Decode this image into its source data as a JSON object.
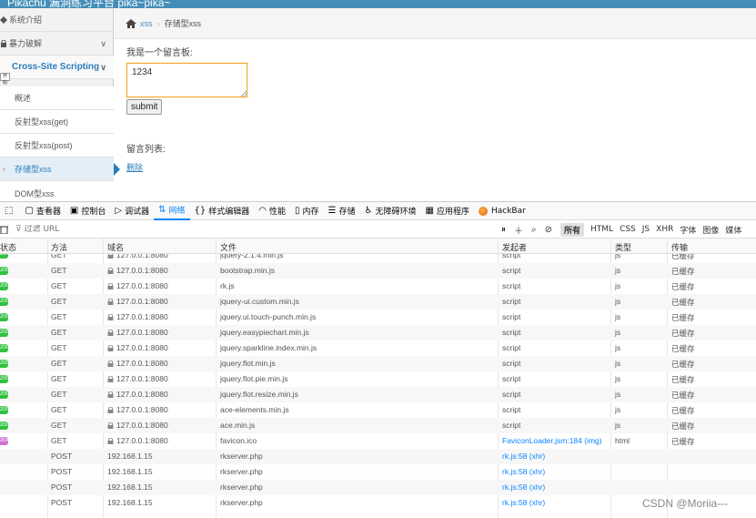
{
  "banner": {
    "title": "Pikachu 漏洞练习平台 pika~pika~"
  },
  "sidebar": {
    "items": [
      {
        "label": "系统介绍"
      },
      {
        "label": "暴力破解"
      },
      {
        "label": "Cross-Site Scripting"
      },
      {
        "label": "概述"
      },
      {
        "label": "反射型xss(get)"
      },
      {
        "label": "反射型xss(post)"
      },
      {
        "label": "存储型xss"
      },
      {
        "label": "DOM型xss"
      }
    ],
    "tooltip_tag": "开始"
  },
  "breadcrumb": {
    "section": "xss",
    "separator": "›",
    "current": "存储型xss"
  },
  "form": {
    "board_label": "我是一个留言板:",
    "message_value": "1234",
    "submit_label": "submit",
    "list_label": "留言列表:",
    "delete_label": "删除"
  },
  "devtools": {
    "tabs": [
      {
        "icon": "inspector-icon",
        "label": "查看器"
      },
      {
        "icon": "console-icon",
        "label": "控制台"
      },
      {
        "icon": "debugger-icon",
        "label": "调试器"
      },
      {
        "icon": "network-icon",
        "label": "网络"
      },
      {
        "icon": "style-editor-icon",
        "label": "样式编辑器"
      },
      {
        "icon": "performance-icon",
        "label": "性能"
      },
      {
        "icon": "memory-icon",
        "label": "内存"
      },
      {
        "icon": "storage-icon",
        "label": "存储"
      },
      {
        "icon": "accessibility-icon",
        "label": "无障碍环境"
      },
      {
        "icon": "application-icon",
        "label": "应用程序"
      },
      {
        "icon": "hackbar-icon",
        "label": "HackBar"
      }
    ],
    "active_tab": "网络",
    "filter_placeholder": "过滤 URL",
    "type_filters": [
      "所有",
      "HTML",
      "CSS",
      "JS",
      "XHR",
      "字体",
      "图像",
      "媒体"
    ],
    "selected_type_filter": "所有",
    "columns": {
      "status": "状态",
      "method": "方法",
      "domain": "域名",
      "file": "文件",
      "initiator": "发起者",
      "type": "类型",
      "transferred": "传输"
    },
    "requests": [
      {
        "status": "200",
        "method": "GET",
        "domain": "127.0.0.1:8080",
        "file": "jquery-2.1.4.min.js",
        "initiator": "script",
        "type": "js",
        "transferred": "已缓存",
        "secure_lock": true,
        "partial": true
      },
      {
        "status": "200",
        "method": "GET",
        "domain": "127.0.0.1:8080",
        "file": "bootstrap.min.js",
        "initiator": "script",
        "type": "js",
        "transferred": "已缓存",
        "secure_lock": true
      },
      {
        "status": "200",
        "method": "GET",
        "domain": "127.0.0.1:8080",
        "file": "rk.js",
        "initiator": "script",
        "type": "js",
        "transferred": "已缓存",
        "secure_lock": true
      },
      {
        "status": "200",
        "method": "GET",
        "domain": "127.0.0.1:8080",
        "file": "jquery-ui.custom.min.js",
        "initiator": "script",
        "type": "js",
        "transferred": "已缓存",
        "secure_lock": true
      },
      {
        "status": "200",
        "method": "GET",
        "domain": "127.0.0.1:8080",
        "file": "jquery.ui.touch-punch.min.js",
        "initiator": "script",
        "type": "js",
        "transferred": "已缓存",
        "secure_lock": true
      },
      {
        "status": "200",
        "method": "GET",
        "domain": "127.0.0.1:8080",
        "file": "jquery.easypiechart.min.js",
        "initiator": "script",
        "type": "js",
        "transferred": "已缓存",
        "secure_lock": true
      },
      {
        "status": "200",
        "method": "GET",
        "domain": "127.0.0.1:8080",
        "file": "jquery.sparkline.index.min.js",
        "initiator": "script",
        "type": "js",
        "transferred": "已缓存",
        "secure_lock": true
      },
      {
        "status": "200",
        "method": "GET",
        "domain": "127.0.0.1:8080",
        "file": "jquery.flot.min.js",
        "initiator": "script",
        "type": "js",
        "transferred": "已缓存",
        "secure_lock": true
      },
      {
        "status": "200",
        "method": "GET",
        "domain": "127.0.0.1:8080",
        "file": "jquery.flot.pie.min.js",
        "initiator": "script",
        "type": "js",
        "transferred": "已缓存",
        "secure_lock": true
      },
      {
        "status": "200",
        "method": "GET",
        "domain": "127.0.0.1:8080",
        "file": "jquery.flot.resize.min.js",
        "initiator": "script",
        "type": "js",
        "transferred": "已缓存",
        "secure_lock": true
      },
      {
        "status": "200",
        "method": "GET",
        "domain": "127.0.0.1:8080",
        "file": "ace-elements.min.js",
        "initiator": "script",
        "type": "js",
        "transferred": "已缓存",
        "secure_lock": true
      },
      {
        "status": "200",
        "method": "GET",
        "domain": "127.0.0.1:8080",
        "file": "ace.min.js",
        "initiator": "script",
        "type": "js",
        "transferred": "已缓存",
        "secure_lock": true
      },
      {
        "status": "304",
        "method": "GET",
        "domain": "127.0.0.1:8080",
        "file": "favicon.ico",
        "initiator": "FaviconLoader.jsm:184 (img)",
        "type": "html",
        "transferred": "已缓存",
        "secure_lock": true,
        "initiator_link": true,
        "img": true
      },
      {
        "status": "",
        "method": "POST",
        "domain": "192.168.1.15",
        "file": "rkserver.php",
        "initiator": "rk.js:58 (xhr)",
        "type": "",
        "transferred": "",
        "secure_lock": false,
        "initiator_link": true
      },
      {
        "status": "",
        "method": "POST",
        "domain": "192.168.1.15",
        "file": "rkserver.php",
        "initiator": "rk.js:58 (xhr)",
        "type": "",
        "transferred": "",
        "secure_lock": false,
        "initiator_link": true
      },
      {
        "status": "",
        "method": "POST",
        "domain": "192.168.1.15",
        "file": "rkserver.php",
        "initiator": "rk.js:58 (xhr)",
        "type": "",
        "transferred": "",
        "secure_lock": false,
        "initiator_link": true
      },
      {
        "status": "",
        "method": "POST",
        "domain": "192.168.1.15",
        "file": "rkserver.php",
        "initiator": "rk.js:58 (xhr)",
        "type": "",
        "transferred": "",
        "secure_lock": false,
        "initiator_link": true
      }
    ]
  },
  "watermark": "CSDN @Moriia---",
  "colors": {
    "accent": "#2b7dbc",
    "network_active": "#0a84ff",
    "status_ok": "#30c040",
    "status_304": "#d070d0",
    "textarea_border": "#f5a623"
  }
}
